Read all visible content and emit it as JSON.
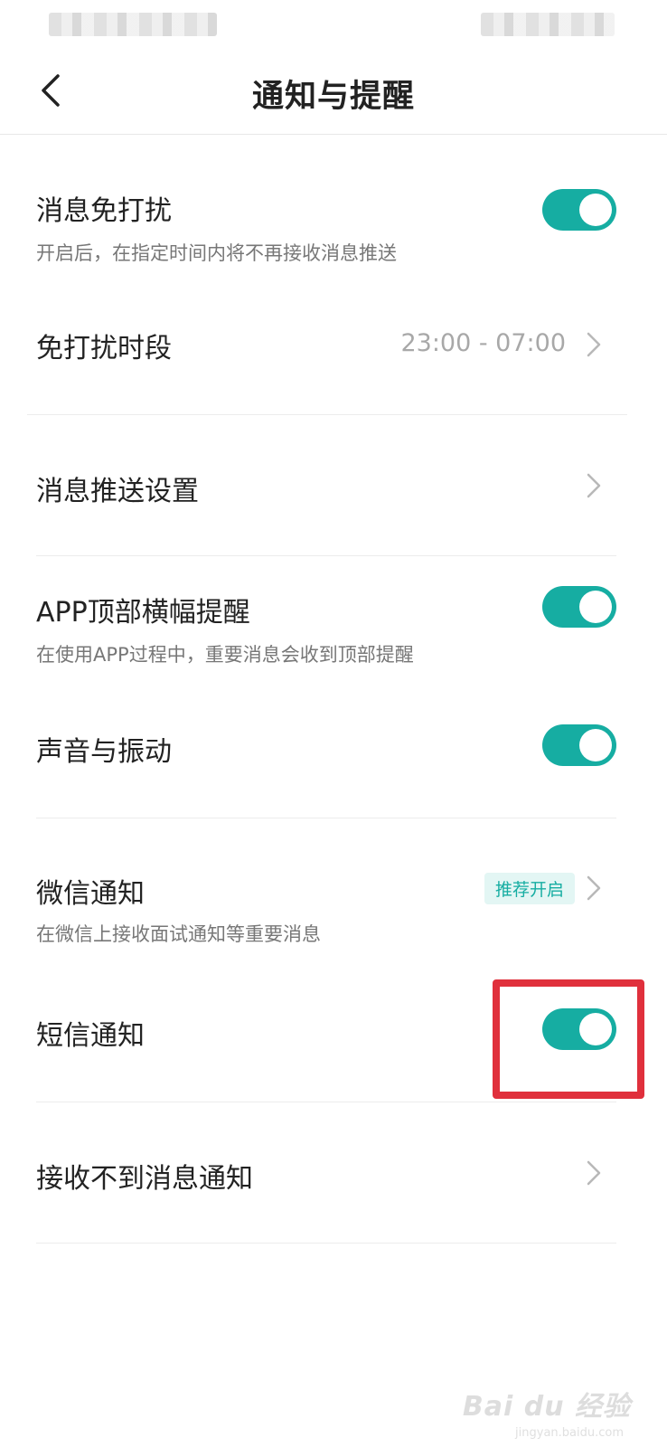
{
  "header": {
    "title": "通知与提醒",
    "back_icon": "chevron-left-icon"
  },
  "settings": {
    "dnd": {
      "title": "消息免打扰",
      "description": "开启后，在指定时间内将不再接收消息推送",
      "enabled": true
    },
    "dnd_period": {
      "title": "免打扰时段",
      "value": "23:00 - 07:00"
    },
    "push_settings": {
      "title": "消息推送设置"
    },
    "app_banner": {
      "title": "APP顶部横幅提醒",
      "description": "在使用APP过程中，重要消息会收到顶部提醒",
      "enabled": true
    },
    "sound_vibration": {
      "title": "声音与振动",
      "enabled": true
    },
    "wechat_notify": {
      "title": "微信通知",
      "description": "在微信上接收面试通知等重要消息",
      "badge": "推荐开启"
    },
    "sms_notify": {
      "title": "短信通知",
      "enabled": true
    },
    "not_receiving": {
      "title": "接收不到消息通知"
    }
  },
  "colors": {
    "accent": "#16ada2",
    "highlight": "#e0303c"
  },
  "watermark": {
    "brand": "Bai du 经验",
    "site": "jingyan.baidu.com"
  }
}
